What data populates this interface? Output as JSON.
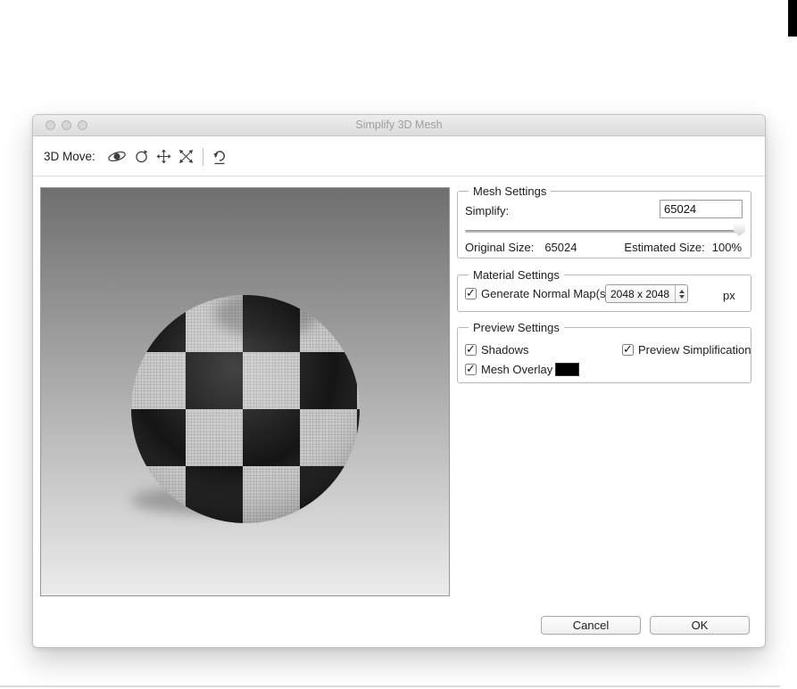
{
  "window": {
    "title": "Simplify 3D Mesh",
    "toolbar_label": "3D Move:",
    "toolbar_icons": [
      "orbit-rotate",
      "roll",
      "pan",
      "slide",
      "reset-view"
    ]
  },
  "mesh_settings": {
    "legend": "Mesh Settings",
    "simplify_label": "Simplify:",
    "simplify_value": "65024",
    "slider_percent": 100,
    "original_size_label": "Original Size:",
    "original_size_value": "65024",
    "estimated_size_label": "Estimated Size:",
    "estimated_size_value": "100%"
  },
  "material_settings": {
    "legend": "Material Settings",
    "generate_normal_maps": {
      "label": "Generate Normal Map(s)",
      "checked": true
    },
    "map_size": {
      "value": "2048 x 2048"
    },
    "unit_label": "px"
  },
  "preview_settings": {
    "legend": "Preview Settings",
    "shadows": {
      "label": "Shadows",
      "checked": true
    },
    "preview_simplification": {
      "label": "Preview Simplification",
      "checked": true
    },
    "mesh_overlay": {
      "label": "Mesh Overlay",
      "checked": true,
      "color": "#000000"
    }
  },
  "actions": {
    "cancel_label": "Cancel",
    "ok_label": "OK"
  }
}
